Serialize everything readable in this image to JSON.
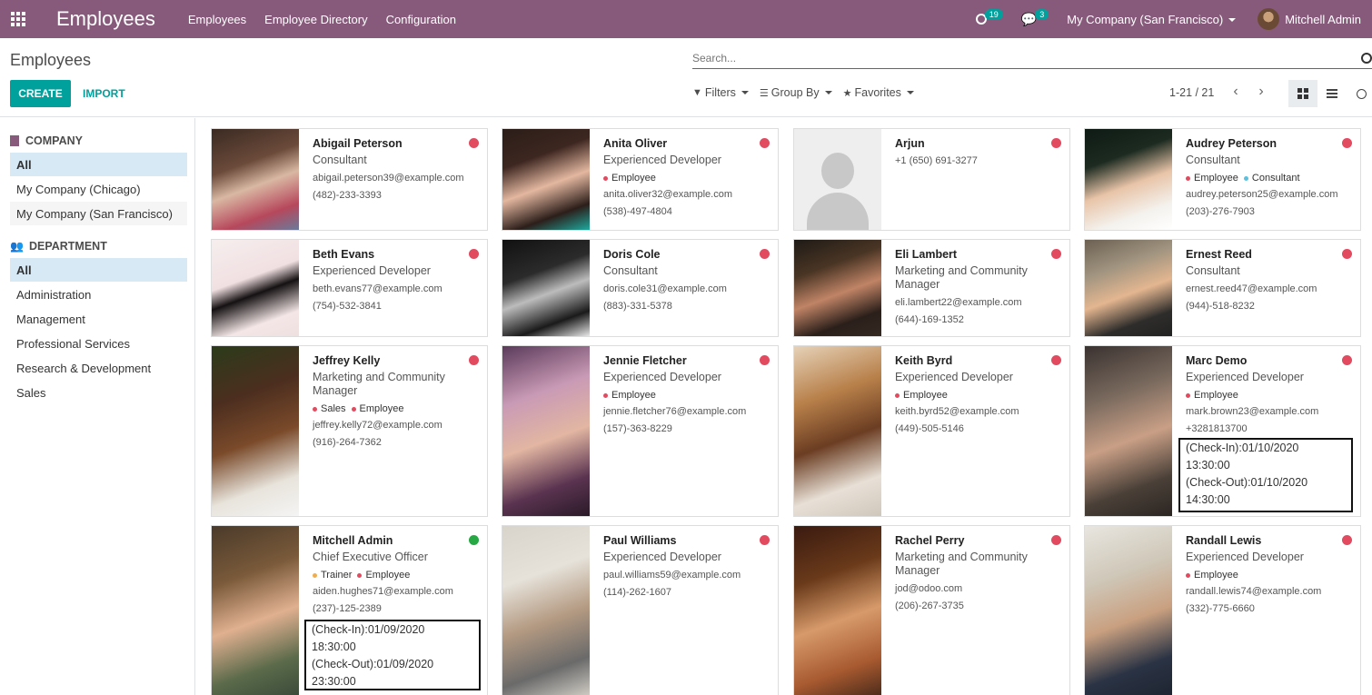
{
  "topbar": {
    "app_title": "Employees",
    "menu": [
      "Employees",
      "Employee Directory",
      "Configuration"
    ],
    "activity_count": "19",
    "message_count": "3",
    "company": "My Company (San Francisco)",
    "user": "Mitchell Admin"
  },
  "control": {
    "breadcrumb": "Employees",
    "search_placeholder": "Search...",
    "create_label": "CREATE",
    "import_label": "IMPORT",
    "filters_label": "Filters",
    "groupby_label": "Group By",
    "favorites_label": "Favorites",
    "pager": "1-21 / 21"
  },
  "sidebar": {
    "company_header": "COMPANY",
    "companies": [
      "All",
      "My Company (Chicago)",
      "My Company (San Francisco)"
    ],
    "department_header": "DEPARTMENT",
    "departments": [
      "All",
      "Administration",
      "Management",
      "Professional Services",
      "Research & Development",
      "Sales"
    ]
  },
  "employees": [
    {
      "name": "Abigail Peterson",
      "job": "Consultant",
      "tags": [],
      "email": "abigail.peterson39@example.com",
      "phone": "(482)-233-3393"
    },
    {
      "name": "Anita Oliver",
      "job": "Experienced Developer",
      "tags": [
        "Employee"
      ],
      "email": "anita.oliver32@example.com",
      "phone": "(538)-497-4804"
    },
    {
      "name": "Arjun",
      "job": "",
      "tags": [],
      "email": "",
      "phone": "+1 (650) 691-3277"
    },
    {
      "name": "Audrey Peterson",
      "job": "Consultant",
      "tags": [
        "Employee",
        "Consultant"
      ],
      "email": "audrey.peterson25@example.com",
      "phone": "(203)-276-7903"
    },
    {
      "name": "Beth Evans",
      "job": "Experienced Developer",
      "tags": [],
      "email": "beth.evans77@example.com",
      "phone": "(754)-532-3841"
    },
    {
      "name": "Doris Cole",
      "job": "Consultant",
      "tags": [],
      "email": "doris.cole31@example.com",
      "phone": "(883)-331-5378"
    },
    {
      "name": "Eli Lambert",
      "job": "Marketing and Community Manager",
      "tags": [],
      "email": "eli.lambert22@example.com",
      "phone": "(644)-169-1352"
    },
    {
      "name": "Ernest Reed",
      "job": "Consultant",
      "tags": [],
      "email": "ernest.reed47@example.com",
      "phone": "(944)-518-8232"
    },
    {
      "name": "Jeffrey Kelly",
      "job": "Marketing and Community Manager",
      "tags": [
        "Sales",
        "Employee"
      ],
      "email": "jeffrey.kelly72@example.com",
      "phone": "(916)-264-7362"
    },
    {
      "name": "Jennie Fletcher",
      "job": "Experienced Developer",
      "tags": [
        "Employee"
      ],
      "email": "jennie.fletcher76@example.com",
      "phone": "(157)-363-8229"
    },
    {
      "name": "Keith Byrd",
      "job": "Experienced Developer",
      "tags": [
        "Employee"
      ],
      "email": "keith.byrd52@example.com",
      "phone": "(449)-505-5146"
    },
    {
      "name": "Marc Demo",
      "job": "Experienced Developer",
      "tags": [
        "Employee"
      ],
      "email": "mark.brown23@example.com",
      "phone": "+3281813700"
    },
    {
      "name": "Mitchell Admin",
      "job": "Chief Executive Officer",
      "tags": [
        "Trainer",
        "Employee"
      ],
      "email": "aiden.hughes71@example.com",
      "phone": "(237)-125-2389"
    },
    {
      "name": "Paul Williams",
      "job": "Experienced Developer",
      "tags": [],
      "email": "paul.williams59@example.com",
      "phone": "(114)-262-1607"
    },
    {
      "name": "Rachel Perry",
      "job": "Marketing and Community Manager",
      "tags": [],
      "email": "jod@odoo.com",
      "phone": "(206)-267-3735"
    },
    {
      "name": "Randall Lewis",
      "job": "Experienced Developer",
      "tags": [
        "Employee"
      ],
      "email": "randall.lewis74@example.com",
      "phone": "(332)-775-6660"
    }
  ],
  "attendance": {
    "marc": [
      "(Check-In):01/10/2020",
      "13:30:00",
      "(Check-Out):01/10/2020",
      "14:30:00"
    ],
    "mitchell": [
      "(Check-In):01/09/2020",
      "18:30:00",
      "(Check-Out):01/09/2020",
      "23:30:00"
    ]
  },
  "colors": {
    "brand": "#875a7b",
    "accent": "#00a09d",
    "status_absent": "#e24a5f",
    "status_present": "#28a745"
  }
}
